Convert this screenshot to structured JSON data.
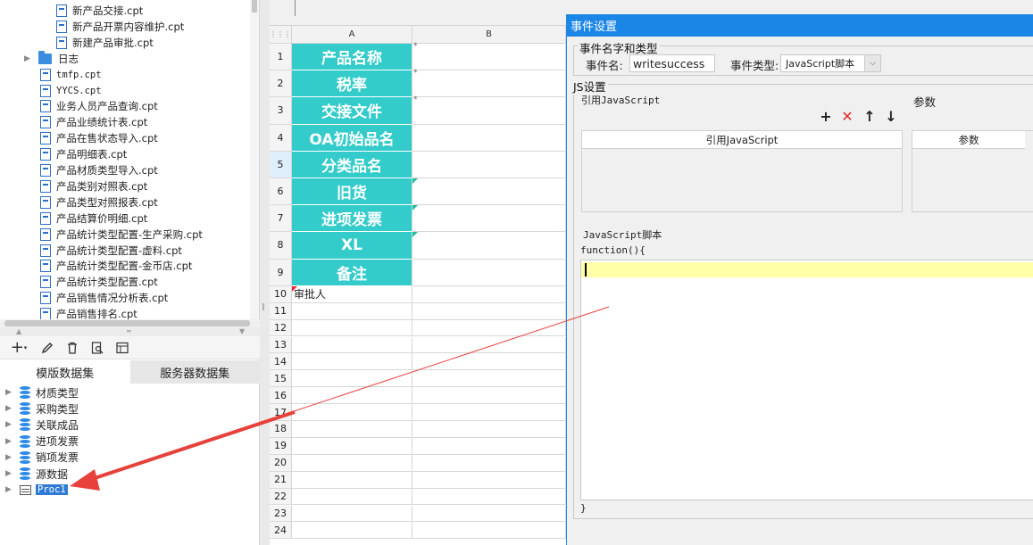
{
  "file_tree": {
    "items": [
      {
        "label": "新产品交接.cpt",
        "kind": "file",
        "level": 2
      },
      {
        "label": "新产品开票内容维护.cpt",
        "kind": "file",
        "level": 2
      },
      {
        "label": "新建产品审批.cpt",
        "kind": "file",
        "level": 2
      },
      {
        "label": "日志",
        "kind": "folder",
        "level": 1
      },
      {
        "label": "tmfp.cpt",
        "kind": "file",
        "level": 1
      },
      {
        "label": "YYCS.cpt",
        "kind": "file",
        "level": 1
      },
      {
        "label": "业务人员产品查询.cpt",
        "kind": "file",
        "level": 1
      },
      {
        "label": "产品业绩统计表.cpt",
        "kind": "file",
        "level": 1
      },
      {
        "label": "产品在售状态导入.cpt",
        "kind": "file",
        "level": 1
      },
      {
        "label": "产品明细表.cpt",
        "kind": "file",
        "level": 1
      },
      {
        "label": "产品材质类型导入.cpt",
        "kind": "file",
        "level": 1
      },
      {
        "label": "产品类别对照表.cpt",
        "kind": "file",
        "level": 1
      },
      {
        "label": "产品类型对照报表.cpt",
        "kind": "file",
        "level": 1
      },
      {
        "label": "产品结算价明细.cpt",
        "kind": "file",
        "level": 1
      },
      {
        "label": "产品统计类型配置-生产采购.cpt",
        "kind": "file",
        "level": 1
      },
      {
        "label": "产品统计类型配置-虚料.cpt",
        "kind": "file",
        "level": 1
      },
      {
        "label": "产品统计类型配置-金币店.cpt",
        "kind": "file",
        "level": 1
      },
      {
        "label": "产品统计类型配置.cpt",
        "kind": "file",
        "level": 1
      },
      {
        "label": "产品销售情况分析表.cpt",
        "kind": "file",
        "level": 1
      },
      {
        "label": "产品销售排名.cpt",
        "kind": "file",
        "level": 1
      }
    ]
  },
  "dataset_panel": {
    "tabs": [
      "模版数据集",
      "服务器数据集"
    ],
    "active_tab": 0,
    "datasets": [
      {
        "label": "材质类型",
        "icon": "database-icon"
      },
      {
        "label": "采购类型",
        "icon": "database-icon"
      },
      {
        "label": "关联成品",
        "icon": "database-icon"
      },
      {
        "label": "进项发票",
        "icon": "database-icon"
      },
      {
        "label": "销项发票",
        "icon": "database-icon"
      },
      {
        "label": "源数据",
        "icon": "database-icon"
      },
      {
        "label": "Proc1",
        "icon": "procedure-icon",
        "selected": true
      }
    ]
  },
  "sheet": {
    "columns": [
      "A",
      "B"
    ],
    "rows": [
      "1",
      "2",
      "3",
      "4",
      "5",
      "6",
      "7",
      "8",
      "9",
      "10",
      "11",
      "12",
      "13",
      "14",
      "15",
      "16",
      "17",
      "18",
      "19",
      "20",
      "21",
      "22",
      "23",
      "24"
    ],
    "selected_row": 4,
    "teal_cells": [
      "产品名称",
      "税率",
      "交接文件",
      "OA初始品名",
      "分类品名",
      "旧货",
      "进项发票",
      "XL",
      "备注"
    ],
    "row10_text": "审批人",
    "teal_color": "#34cbcb"
  },
  "dialog": {
    "title": "事件设置",
    "name_group": {
      "legend": "事件名字和类型",
      "name_label": "事件名:",
      "name_value": "writesuccess",
      "type_label": "事件类型:",
      "type_value": "JavaScript脚本"
    },
    "js_group": {
      "legend": "JS设置",
      "ref_label": "引用JavaScript",
      "param_label": "参数",
      "ref_column": "引用JavaScript",
      "param_column": "参数",
      "script_label": "JavaScript脚本",
      "code_start": "function(){",
      "code_end": "}"
    },
    "title_color": "#1c86e6"
  },
  "annotation": {
    "arrow_color": "#e8403a"
  }
}
